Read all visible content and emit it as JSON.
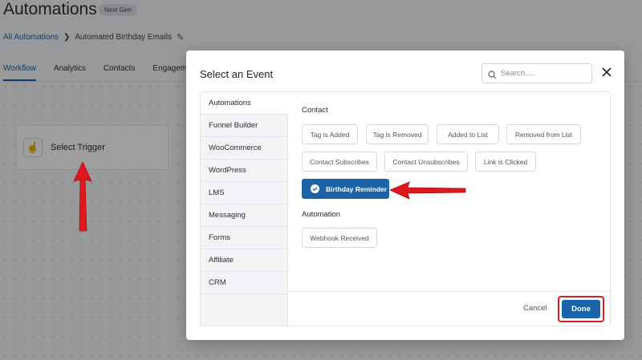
{
  "page": {
    "title": "Automations",
    "badge": "Next Gen",
    "breadcrumb": {
      "root": "All Automations",
      "current": "Automated Birthday Emails"
    },
    "tabs": [
      "Workflow",
      "Analytics",
      "Contacts",
      "Engagements"
    ],
    "trigger_label": "Select Trigger"
  },
  "modal": {
    "title": "Select an Event",
    "search_placeholder": "Search.....",
    "close_icon": "close-icon",
    "sidebar": [
      "Automations",
      "Funnel Builder",
      "WooCommerce",
      "WordPress",
      "LMS",
      "Messaging",
      "Forms",
      "Affiliate",
      "CRM"
    ],
    "sections": {
      "contact_label": "Contact",
      "contact_events": [
        "Tag is Added",
        "Tag is Removed",
        "Added to List",
        "Removed from List",
        "Contact Subscribes",
        "Contact Unsubscribes",
        "Link is Clicked",
        "Birthday Reminder"
      ],
      "automation_label": "Automation",
      "automation_events": [
        "Webhook Received"
      ]
    },
    "cancel_label": "Cancel",
    "done_label": "Done"
  },
  "colors": {
    "primary": "#1a64a7",
    "highlight": "#d91f26"
  }
}
